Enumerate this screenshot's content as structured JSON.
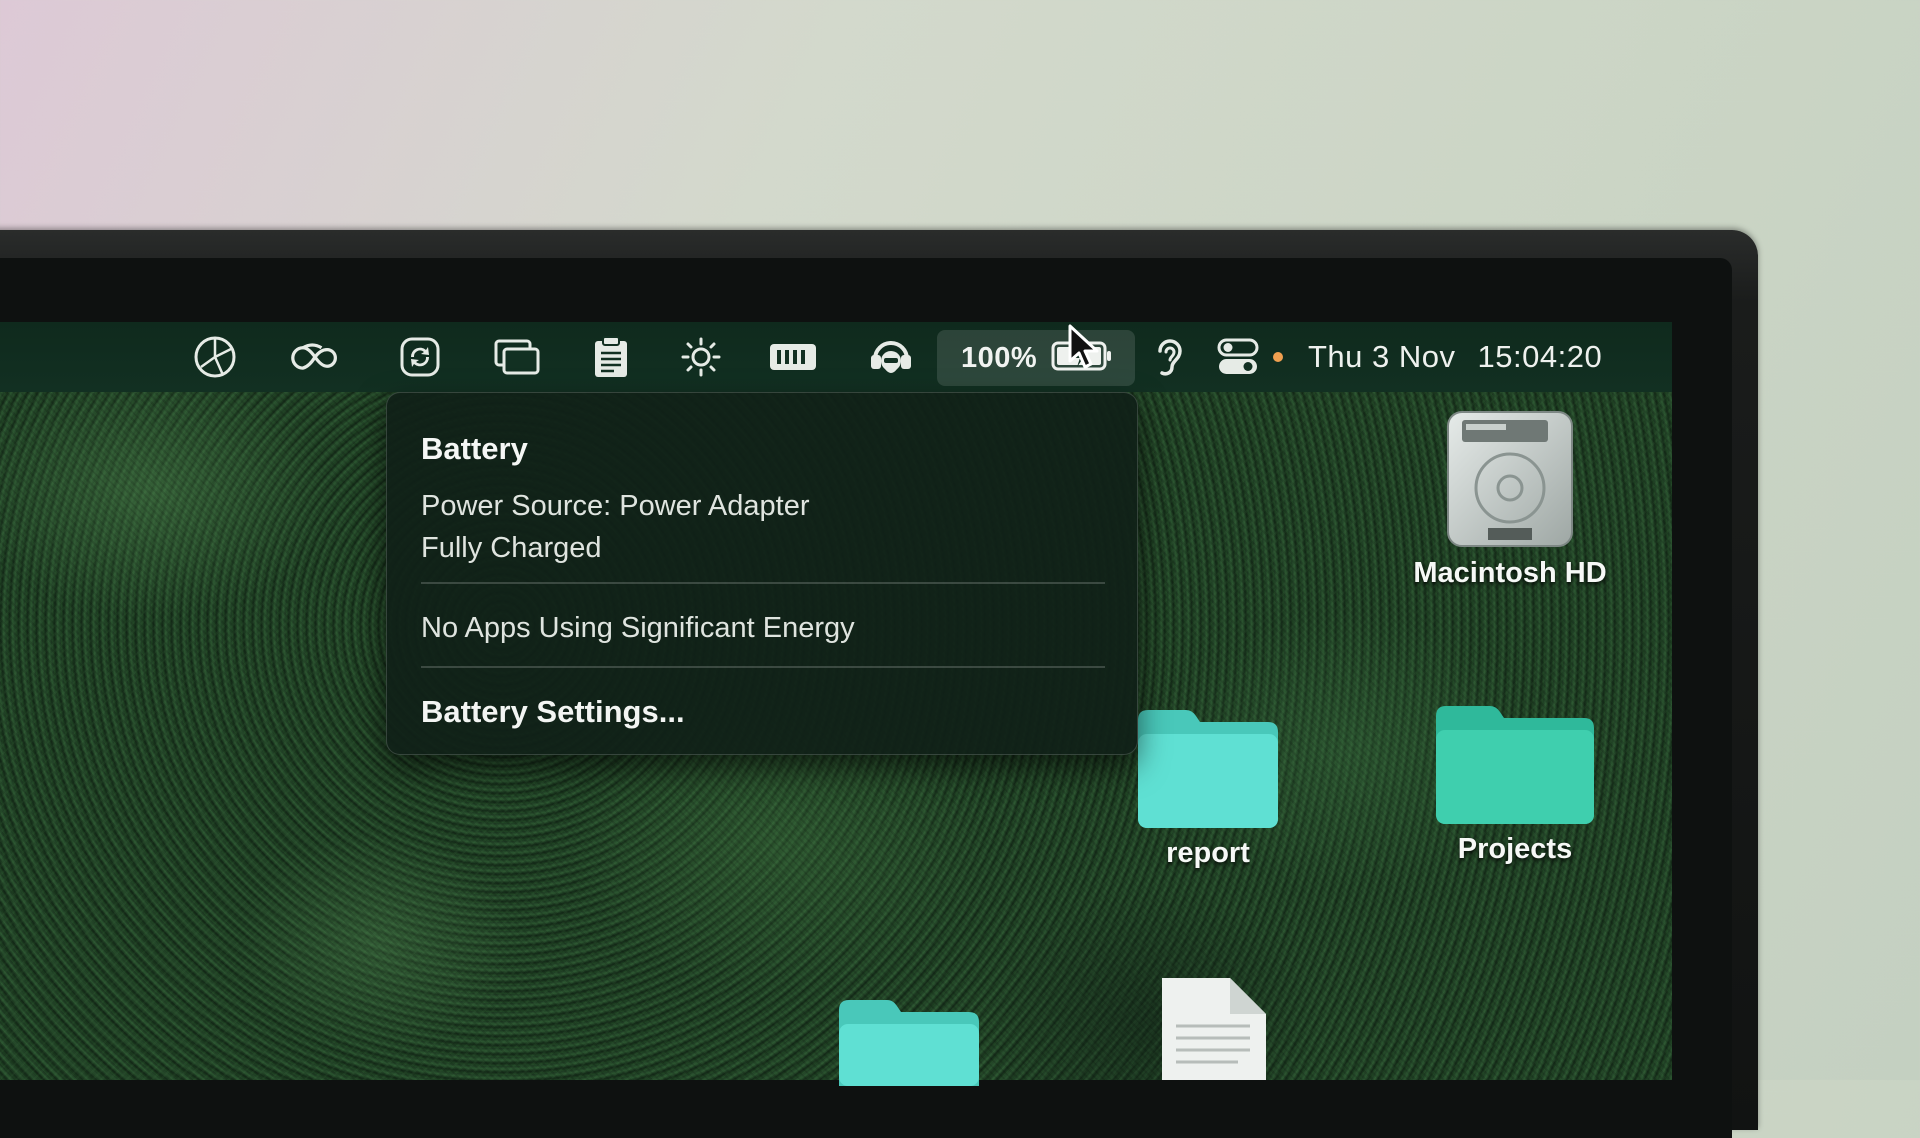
{
  "menubar": {
    "icons": [
      {
        "name": "aperture-icon"
      },
      {
        "name": "creative-cloud-icon"
      },
      {
        "name": "sync-app-icon"
      },
      {
        "name": "windows-icon"
      },
      {
        "name": "clipboard-icon"
      },
      {
        "name": "brightness-icon"
      },
      {
        "name": "memory-icon"
      },
      {
        "name": "headset-icon"
      },
      {
        "name": "hearing-icon"
      },
      {
        "name": "control-center-icon"
      }
    ],
    "battery_percent": "100%",
    "date": "Thu 3 Nov",
    "time": "15:04:20"
  },
  "battery_menu": {
    "title": "Battery",
    "power_source": "Power Source: Power Adapter",
    "status": "Fully Charged",
    "energy_info": "No Apps Using Significant Energy",
    "settings_label": "Battery Settings..."
  },
  "desktop": {
    "items": [
      {
        "label": "Macintosh HD",
        "type": "drive"
      },
      {
        "label": "report",
        "type": "folder"
      },
      {
        "label": "Projects",
        "type": "folder"
      }
    ]
  },
  "colors": {
    "menubar_bg": "#123022",
    "popover_bg": "#102018",
    "folder_teal": "#4fd6c8",
    "status_dot": "#f0a050"
  }
}
